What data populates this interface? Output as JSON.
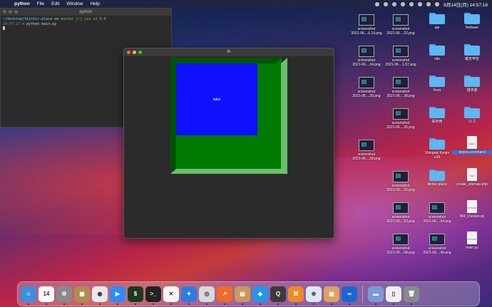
{
  "menubar": {
    "apple": "",
    "app_name": "python",
    "menus": [
      "File",
      "Edit",
      "Window",
      "Help"
    ],
    "clock": "6月14日(月)  14:57:18"
  },
  "terminal": {
    "title": "python",
    "line1_path": "~/desktop/tkinter-place",
    "line1_rest": " on ",
    "line1_branch": "master [!] via",
    "line1_ver": " v3.9.0",
    "line2_time": "14:57:17",
    "line2_cmd": " > python main.py"
  },
  "tk_window": {
    "title": "tk",
    "label_text": "label",
    "colors": {
      "frame": "#007a00",
      "label_bg": "#1010ff",
      "bevel_light": "#69c06a"
    }
  },
  "desktop": {
    "screenshots": [
      "screenshot\n2021-06....6.19.png",
      "screenshot\n2021-06....22.png",
      "screenshot\n2021-06....34.png",
      "screenshot\n2021-06....1.57.png",
      "screenshot\n2021-06....20.png",
      "screenshot\n2021-06....38.png",
      "screenshot\n2021-06....26.png",
      "screenshot\n2021-06....28.png",
      "screenshot\n2021-06....25.png",
      "screenshot\n2021-06....53.png",
      "screenshot\n2021-06....34.png",
      "screenshot\n2021-06....08.png",
      "screenshot\n2021-06....48.png"
    ],
    "folders": [
      "api",
      "firebase",
      "site",
      "確定申告",
      "front",
      "請求書",
      "保存用",
      "ロゴ",
      "Shingeki Kyojin\nv34",
      "tkinter-place"
    ],
    "files": [
      "deploy.command",
      "create_sitemap.php",
      "404_checker.py",
      "main.py"
    ],
    "file_types": [
      "SHELL",
      "PHP",
      "PYTHON",
      "PYTHON"
    ]
  },
  "dock": {
    "apps": [
      {
        "name": "finder-icon",
        "color": "#3d8fe0",
        "glyph": "☺"
      },
      {
        "name": "calendar-icon",
        "color": "#ffffff",
        "glyph": "14"
      },
      {
        "name": "system-preferences-icon",
        "color": "#8a8a8a",
        "glyph": "⚙"
      },
      {
        "name": "notes-icon",
        "color": "#b38b4f",
        "glyph": "▦"
      },
      {
        "name": "chrome-icon",
        "color": "#e8e8e8",
        "glyph": "◉"
      },
      {
        "name": "zoom-icon",
        "color": "#2d8cff",
        "glyph": "▶"
      },
      {
        "name": "iterm-icon",
        "color": "#1e3a1e",
        "glyph": "$"
      },
      {
        "name": "terminal-icon",
        "color": "#222222",
        "glyph": ">_"
      },
      {
        "name": "vscode-icon",
        "color": "#f4f4f4",
        "glyph": "✕"
      },
      {
        "name": "safari-icon",
        "color": "#2a7ee0",
        "glyph": "✦"
      },
      {
        "name": "sequel-icon",
        "color": "#d9d9d9",
        "glyph": "◎"
      },
      {
        "name": "activity-icon",
        "color": "#f06a2a",
        "glyph": "↗"
      },
      {
        "name": "archive-icon",
        "color": "#c79a5a",
        "glyph": "▤"
      },
      {
        "name": "docker-icon",
        "color": "#2496ed",
        "glyph": "◆"
      },
      {
        "name": "quicktime-icon",
        "color": "#3a3a3a",
        "glyph": "Q"
      },
      {
        "name": "sourcetree-icon",
        "color": "#f08a24",
        "glyph": "⌘"
      },
      {
        "name": "mysql-icon",
        "color": "#dfe8f0",
        "glyph": "⊕"
      },
      {
        "name": "photo-icon",
        "color": "#e0a060",
        "glyph": "▣"
      },
      {
        "name": "infinity-icon",
        "color": "#1a66d0",
        "glyph": "∞"
      }
    ],
    "right_items": [
      {
        "name": "screenshot-stack-icon",
        "color": "#7a9ad8",
        "glyph": "▬"
      },
      {
        "name": "document-stack-icon",
        "color": "#f0f0f0",
        "glyph": "▯"
      },
      {
        "name": "trash-icon",
        "color": "#8a8a8a",
        "glyph": "🗑"
      }
    ]
  }
}
